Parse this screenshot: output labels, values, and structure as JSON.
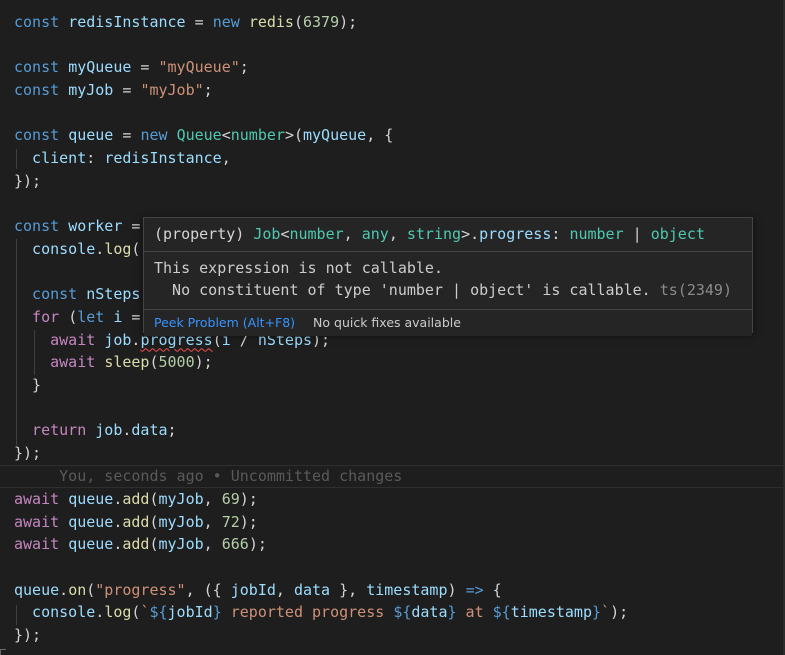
{
  "code_lines": [
    [
      {
        "t": "const ",
        "c": "k"
      },
      {
        "t": "redisInstance",
        "c": "v"
      },
      {
        "t": " = ",
        "c": "p"
      },
      {
        "t": "new ",
        "c": "k"
      },
      {
        "t": "redis",
        "c": "f"
      },
      {
        "t": "(",
        "c": "p"
      },
      {
        "t": "6379",
        "c": "n"
      },
      {
        "t": ");",
        "c": "p"
      }
    ],
    [],
    [
      {
        "t": "const ",
        "c": "k"
      },
      {
        "t": "myQueue",
        "c": "v"
      },
      {
        "t": " = ",
        "c": "p"
      },
      {
        "t": "\"myQueue\"",
        "c": "s"
      },
      {
        "t": ";",
        "c": "p"
      }
    ],
    [
      {
        "t": "const ",
        "c": "k"
      },
      {
        "t": "myJob",
        "c": "v"
      },
      {
        "t": " = ",
        "c": "p"
      },
      {
        "t": "\"myJob\"",
        "c": "s"
      },
      {
        "t": ";",
        "c": "p"
      }
    ],
    [],
    [
      {
        "t": "const ",
        "c": "k"
      },
      {
        "t": "queue",
        "c": "v"
      },
      {
        "t": " = ",
        "c": "p"
      },
      {
        "t": "new ",
        "c": "k"
      },
      {
        "t": "Queue",
        "c": "t"
      },
      {
        "t": "<",
        "c": "p"
      },
      {
        "t": "number",
        "c": "t"
      },
      {
        "t": ">(",
        "c": "p"
      },
      {
        "t": "myQueue",
        "c": "v"
      },
      {
        "t": ", {",
        "c": "p"
      }
    ],
    [
      {
        "t": "  client",
        "c": "v"
      },
      {
        "t": ": ",
        "c": "p"
      },
      {
        "t": "redisInstance",
        "c": "v"
      },
      {
        "t": ",",
        "c": "p"
      }
    ],
    [
      {
        "t": "});",
        "c": "p"
      }
    ],
    [],
    [
      {
        "t": "const ",
        "c": "k"
      },
      {
        "t": "worker",
        "c": "v"
      },
      {
        "t": " = ",
        "c": "p"
      }
    ],
    [
      {
        "t": "  console",
        "c": "v"
      },
      {
        "t": ".",
        "c": "p"
      },
      {
        "t": "log",
        "c": "f"
      },
      {
        "t": "(",
        "c": "p"
      }
    ],
    [],
    [
      {
        "t": "  const ",
        "c": "k"
      },
      {
        "t": "nSteps",
        "c": "v"
      }
    ],
    [
      {
        "t": "  for ",
        "c": "c"
      },
      {
        "t": "(",
        "c": "p"
      },
      {
        "t": "let ",
        "c": "k"
      },
      {
        "t": "i",
        "c": "v"
      },
      {
        "t": " =",
        "c": "p"
      }
    ],
    [
      {
        "t": "    await ",
        "c": "c"
      },
      {
        "t": "job",
        "c": "v"
      },
      {
        "t": ".",
        "c": "p"
      },
      {
        "t": "progress",
        "c": "v",
        "sq": true
      },
      {
        "t": "(",
        "c": "p"
      },
      {
        "t": "i",
        "c": "v"
      },
      {
        "t": " / ",
        "c": "p"
      },
      {
        "t": "nSteps",
        "c": "v"
      },
      {
        "t": ");",
        "c": "p"
      }
    ],
    [
      {
        "t": "    await ",
        "c": "c"
      },
      {
        "t": "sleep",
        "c": "f"
      },
      {
        "t": "(",
        "c": "p"
      },
      {
        "t": "5000",
        "c": "n"
      },
      {
        "t": ");",
        "c": "p"
      }
    ],
    [
      {
        "t": "  }",
        "c": "p"
      }
    ],
    [],
    [
      {
        "t": "  return ",
        "c": "c"
      },
      {
        "t": "job",
        "c": "v"
      },
      {
        "t": ".",
        "c": "p"
      },
      {
        "t": "data",
        "c": "v"
      },
      {
        "t": ";",
        "c": "p"
      }
    ],
    [
      {
        "t": "});",
        "c": "p"
      }
    ],
    [
      {
        "t": "     You, seconds ago • Uncommitted changes",
        "c": "blame"
      }
    ],
    [
      {
        "t": "await ",
        "c": "c"
      },
      {
        "t": "queue",
        "c": "v"
      },
      {
        "t": ".",
        "c": "p"
      },
      {
        "t": "add",
        "c": "f"
      },
      {
        "t": "(",
        "c": "p"
      },
      {
        "t": "myJob",
        "c": "v"
      },
      {
        "t": ", ",
        "c": "p"
      },
      {
        "t": "69",
        "c": "n"
      },
      {
        "t": ");",
        "c": "p"
      }
    ],
    [
      {
        "t": "await ",
        "c": "c"
      },
      {
        "t": "queue",
        "c": "v"
      },
      {
        "t": ".",
        "c": "p"
      },
      {
        "t": "add",
        "c": "f"
      },
      {
        "t": "(",
        "c": "p"
      },
      {
        "t": "myJob",
        "c": "v"
      },
      {
        "t": ", ",
        "c": "p"
      },
      {
        "t": "72",
        "c": "n"
      },
      {
        "t": ");",
        "c": "p"
      }
    ],
    [
      {
        "t": "await ",
        "c": "c"
      },
      {
        "t": "queue",
        "c": "v"
      },
      {
        "t": ".",
        "c": "p"
      },
      {
        "t": "add",
        "c": "f"
      },
      {
        "t": "(",
        "c": "p"
      },
      {
        "t": "myJob",
        "c": "v"
      },
      {
        "t": ", ",
        "c": "p"
      },
      {
        "t": "666",
        "c": "n"
      },
      {
        "t": ");",
        "c": "p"
      }
    ],
    [],
    [
      {
        "t": "queue",
        "c": "v"
      },
      {
        "t": ".",
        "c": "p"
      },
      {
        "t": "on",
        "c": "f"
      },
      {
        "t": "(",
        "c": "p"
      },
      {
        "t": "\"progress\"",
        "c": "s"
      },
      {
        "t": ", ({ ",
        "c": "p"
      },
      {
        "t": "jobId",
        "c": "v"
      },
      {
        "t": ", ",
        "c": "p"
      },
      {
        "t": "data",
        "c": "v"
      },
      {
        "t": " }, ",
        "c": "p"
      },
      {
        "t": "timestamp",
        "c": "v"
      },
      {
        "t": ") ",
        "c": "p"
      },
      {
        "t": "=>",
        "c": "k"
      },
      {
        "t": " {",
        "c": "p"
      }
    ],
    [
      {
        "t": "  console",
        "c": "v"
      },
      {
        "t": ".",
        "c": "p"
      },
      {
        "t": "log",
        "c": "f"
      },
      {
        "t": "(",
        "c": "p"
      },
      {
        "t": "`",
        "c": "s"
      },
      {
        "t": "${",
        "c": "k"
      },
      {
        "t": "jobId",
        "c": "v"
      },
      {
        "t": "}",
        "c": "k"
      },
      {
        "t": " reported progress ",
        "c": "s"
      },
      {
        "t": "${",
        "c": "k"
      },
      {
        "t": "data",
        "c": "v"
      },
      {
        "t": "}",
        "c": "k"
      },
      {
        "t": " at ",
        "c": "s"
      },
      {
        "t": "${",
        "c": "k"
      },
      {
        "t": "timestamp",
        "c": "v"
      },
      {
        "t": "}",
        "c": "k"
      },
      {
        "t": "`",
        "c": "s"
      },
      {
        "t": ");",
        "c": "p"
      }
    ],
    [
      {
        "t": "});",
        "c": "p"
      }
    ]
  ],
  "hover": {
    "signature": [
      {
        "t": "(property) ",
        "c": "p"
      },
      {
        "t": "Job",
        "c": "t"
      },
      {
        "t": "<",
        "c": "p"
      },
      {
        "t": "number",
        "c": "t"
      },
      {
        "t": ", ",
        "c": "p"
      },
      {
        "t": "any",
        "c": "t"
      },
      {
        "t": ", ",
        "c": "p"
      },
      {
        "t": "string",
        "c": "t"
      },
      {
        "t": ">.",
        "c": "p"
      },
      {
        "t": "progress",
        "c": "v"
      },
      {
        "t": ": ",
        "c": "p"
      },
      {
        "t": "number",
        "c": "t"
      },
      {
        "t": " | ",
        "c": "p"
      },
      {
        "t": "object",
        "c": "t"
      }
    ],
    "message_line1": "This expression is not callable.",
    "message_line2": "  No constituent of type 'number | object' is callable.",
    "error_code": " ts(2349)",
    "peek_problem_label": "Peek Problem (Alt+F8)",
    "no_quick_fixes_label": "No quick fixes available"
  }
}
